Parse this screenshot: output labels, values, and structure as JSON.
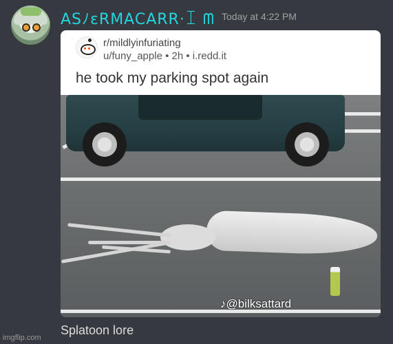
{
  "message": {
    "username": "ASﾉɛRMACARR·ꀤ ᗰ",
    "timestamp": "Today at 4:22 PM",
    "caption": "Splatoon lore"
  },
  "embed": {
    "subreddit": "r/mildlyinfuriating",
    "meta": "u/funy_apple • 2h • i.redd.it",
    "title": "he took my parking spot again",
    "watermark": "♪@bilksattard"
  },
  "footer": {
    "watermark": "imgflip.com"
  },
  "colors": {
    "background": "#36393f",
    "username": "#25d6df",
    "timestamp": "#9fa2a7"
  }
}
